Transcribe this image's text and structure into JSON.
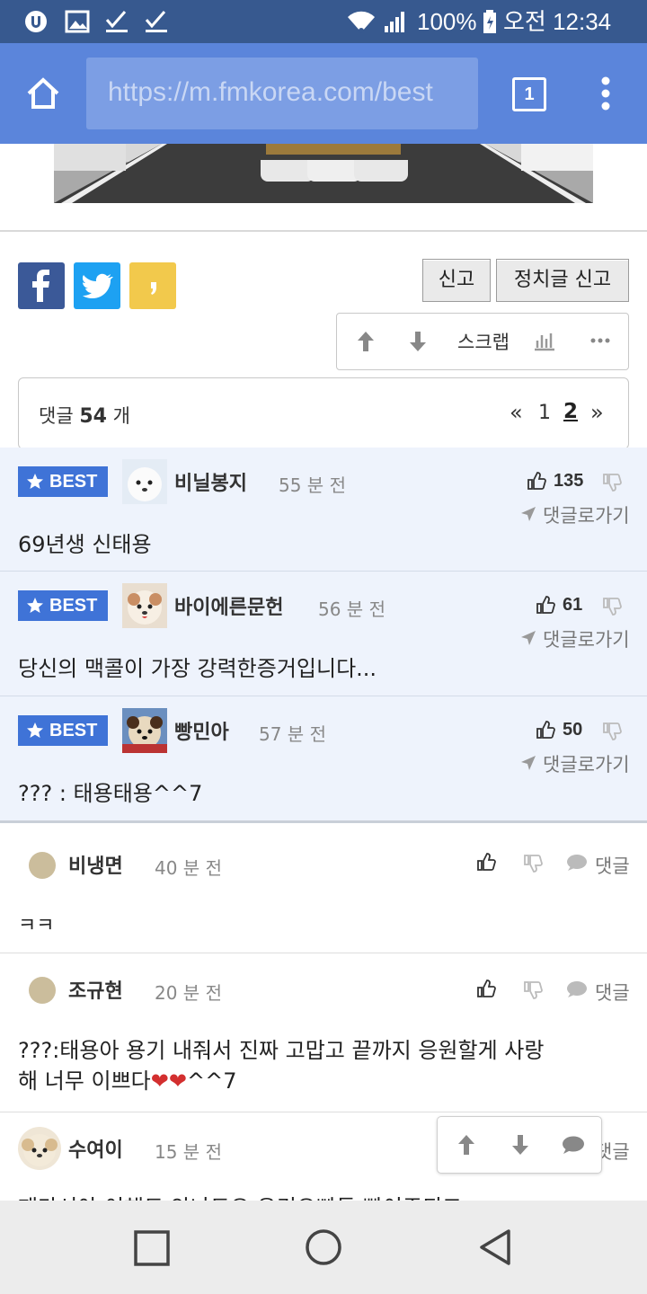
{
  "status_bar": {
    "battery": "100%",
    "time": "오전 12:34",
    "icons": [
      "app-icon",
      "image-icon",
      "check-icon",
      "check-icon",
      "wifi-icon",
      "signal-icon",
      "battery-icon"
    ]
  },
  "browser": {
    "url": "https://m.fmkorea.com/best",
    "tab_count": "1"
  },
  "actions": {
    "report": "신고",
    "political_report": "정치글 신고",
    "scrap": "스크랩"
  },
  "comments_header": {
    "prefix": "댓글",
    "count": "54",
    "suffix": "개",
    "pages": [
      "«",
      "1",
      "2",
      "»"
    ],
    "current_page": "2"
  },
  "best_comments": [
    {
      "badge": "BEST",
      "nick": "비닐봉지",
      "time": "55 분 전",
      "likes": "135",
      "goto": "댓글로가기",
      "text": "69년생 신태용"
    },
    {
      "badge": "BEST",
      "nick": "바이에른문헌",
      "time": "56 분 전",
      "likes": "61",
      "goto": "댓글로가기",
      "text": "당신의 맥콜이 가장 강력한증거입니다..."
    },
    {
      "badge": "BEST",
      "nick": "빵민아",
      "time": "57 분 전",
      "likes": "50",
      "goto": "댓글로가기",
      "text": "??? : 태용태용^^7"
    }
  ],
  "comments": [
    {
      "nick": "비냉면",
      "time": "40 분 전",
      "reply": "댓글",
      "text": "ㅋㅋ"
    },
    {
      "nick": "조규현",
      "time": "20 분 전",
      "reply": "댓글",
      "text_line1": "???:태용아 용기 내줘서 진짜 고맙고 끝까지 응원할게 사랑",
      "text_line2": "해 너무 이쁘다",
      "text_tail": "^^7",
      "hearts": "❤❤"
    },
    {
      "nick": "수여이",
      "time": "15 분 전",
      "reply": "댓글",
      "text_partial": "패마서아 이해도 안나도요 우리오빠들 빵이주되고"
    }
  ],
  "colors": {
    "status_bar": "#37598f",
    "browser_bar": "#5b85db",
    "best_badge": "#3f73d7",
    "best_bg": "#eef3fc",
    "facebook": "#3b5998",
    "twitter": "#1da1f2",
    "kakao": "#f2c94c"
  }
}
